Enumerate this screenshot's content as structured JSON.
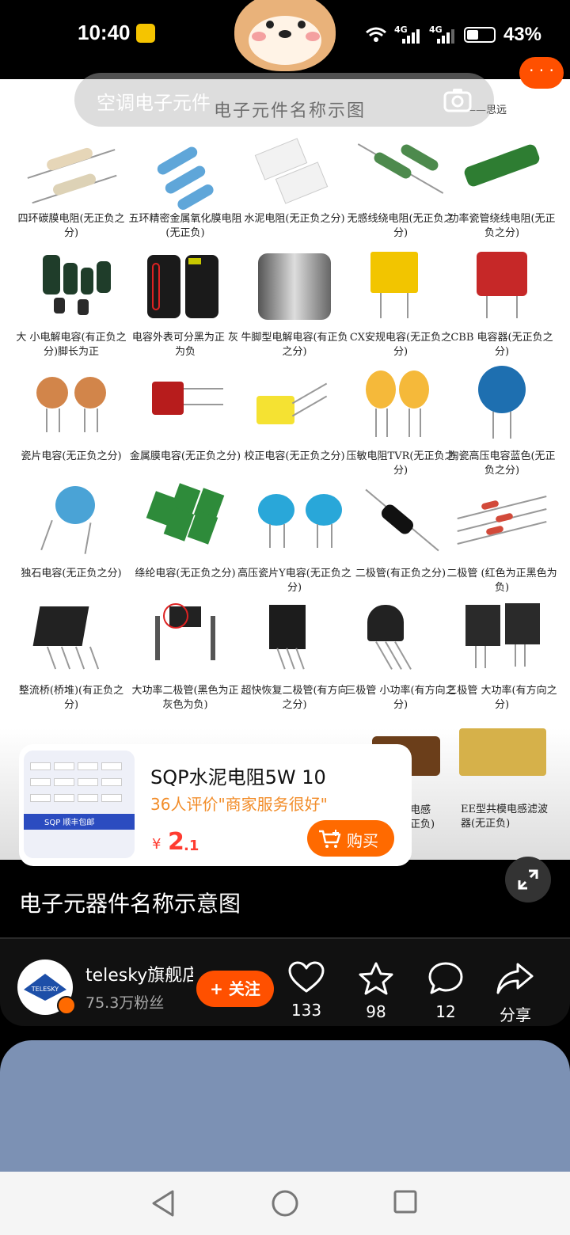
{
  "status_bar": {
    "time": "10:40",
    "battery": "43%",
    "network_1": "4G",
    "network_2": "4G"
  },
  "search": {
    "placeholder": "空调电子元件"
  },
  "image": {
    "title": "电子元件名称示图",
    "author": "——思远",
    "components": [
      {
        "caption": "四环碳膜电阻(无正负之分)"
      },
      {
        "caption": "五环精密金属氧化膜电阻(无正负)"
      },
      {
        "caption": "水泥电阻(无正负之分)"
      },
      {
        "caption": "无感线绕电阻(无正负之分)"
      },
      {
        "caption": "功率瓷管绕线电阻(无正负之分)"
      },
      {
        "caption": "大 小电解电容(有正负之分)脚长为正"
      },
      {
        "caption": "电容外表可分黑为正 灰为负"
      },
      {
        "caption": "牛脚型电解电容(有正负之分)"
      },
      {
        "caption": "CX安规电容(无正负之分)"
      },
      {
        "caption": "CBB 电容器(无正负之分)"
      },
      {
        "caption": "瓷片电容(无正负之分)"
      },
      {
        "caption": "金属膜电容(无正负之分)"
      },
      {
        "caption": "校正电容(无正负之分)"
      },
      {
        "caption": "压敏电阻TVR(无正负之分)"
      },
      {
        "caption": "陶瓷高压电容蓝色(无正负之分)"
      },
      {
        "caption": "独石电容(无正负之分)"
      },
      {
        "caption": "绦纶电容(无正负之分)"
      },
      {
        "caption": "高压瓷片Y电容(无正负之分)"
      },
      {
        "caption": "二极管(有正负之分)"
      },
      {
        "caption": "二极管 (红色为正黑色为负)"
      },
      {
        "caption": "整流桥(桥堆)(有正负之分)"
      },
      {
        "caption": "大功率二极管(黑色为正 灰色为负)"
      },
      {
        "caption": "超快恢复二极管(有方向之分)"
      },
      {
        "caption": "三极管 小功率(有方向之分)"
      },
      {
        "caption": "三极管 大功率(有方向之分)"
      }
    ],
    "partial_captions": [
      "电感",
      "正负)",
      "EE型共模电感滤波器(无正负)"
    ]
  },
  "product": {
    "name": "SQP水泥电阻5W 10",
    "review": "36人评价\"商家服务很好\"",
    "price_symbol": "¥",
    "price_int": "2",
    "price_dec": ".1",
    "buy_label": "购买",
    "thumb_band": "SQP 顺丰包邮"
  },
  "caption": "电子元器件名称示意图",
  "author": {
    "name": "telesky旗舰店",
    "fans": "75.3万粉丝",
    "follow_label": "+ 关注",
    "avatar_text": "TELESKY"
  },
  "actions": {
    "likes": "133",
    "favorites": "98",
    "comments": "12",
    "share_label": "分享"
  },
  "icons": [
    "back-icon",
    "camera-icon",
    "more-icon",
    "expand-icon",
    "heart-icon",
    "star-icon",
    "comment-icon",
    "share-icon",
    "cart-icon"
  ],
  "colors": {
    "accent": "#ff5000",
    "review": "#f28d2a",
    "price": "#ff3b30"
  }
}
